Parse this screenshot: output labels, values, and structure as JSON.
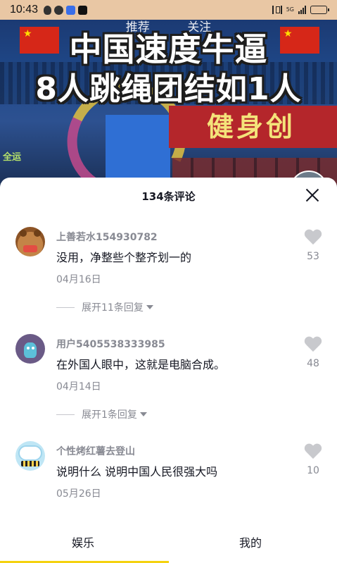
{
  "status_bar": {
    "time": "10:43",
    "left_icons": [
      "shield-icon",
      "circle-icon",
      "app-icon",
      "tiktok-icon"
    ],
    "network_label": "5G",
    "battery_level": 0.35
  },
  "video": {
    "top_tabs": [
      "推荐",
      "关注"
    ],
    "caption_line1": "中国速度牛逼",
    "caption_line2": "8人跳绳团结如1人",
    "banner_text": "健身创",
    "corner_text": "全运"
  },
  "comments_sheet": {
    "title": "134条评论",
    "comments": [
      {
        "username": "上善若水154930782",
        "text": "没用，净整些个整齐划一的",
        "date": "04月16日",
        "likes": "53",
        "expand_label": "展开11条回复"
      },
      {
        "username": "用户5405538333985",
        "text": "在外国人眼中，这就是电脑合成。",
        "date": "04月14日",
        "likes": "48",
        "expand_label": "展开1条回复"
      },
      {
        "username": "个性烤红薯去登山",
        "text": "说明什么 说明中国人民很强大吗",
        "date": "05月26日",
        "likes": "10"
      }
    ]
  },
  "bottom_tabs": {
    "tab1": "娱乐",
    "tab2": "我的"
  },
  "colors": {
    "status_bar_bg": "#e9c7a4",
    "sheet_bg": "#ffffff",
    "secondary_text": "#888a93",
    "tab_indicator": "#f4d20f"
  }
}
